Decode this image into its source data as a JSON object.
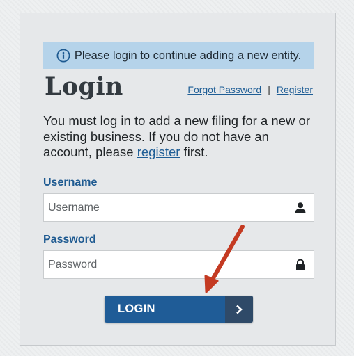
{
  "alert": {
    "icon": "info-circle-icon",
    "text": "Please login to continue adding a new entity."
  },
  "title": "Login",
  "links": {
    "forgot_password": "Forgot Password",
    "separator": "|",
    "register": "Register"
  },
  "intro": {
    "before_link": "You must log in to add a new filing for a new or existing business. If you do not have an account, please ",
    "link": "register",
    "after_link": " first."
  },
  "username": {
    "label": "Username",
    "placeholder": "Username",
    "value": "",
    "icon": "user-icon"
  },
  "password": {
    "label": "Password",
    "placeholder": "Password",
    "value": "",
    "icon": "lock-icon"
  },
  "login_button": {
    "label": "LOGIN",
    "icon": "chevron-right-icon"
  },
  "colors": {
    "accent": "#1f5c97",
    "alert_bg": "#b5d3ea",
    "label": "#1e5a91",
    "annotation": "#d63a20"
  }
}
